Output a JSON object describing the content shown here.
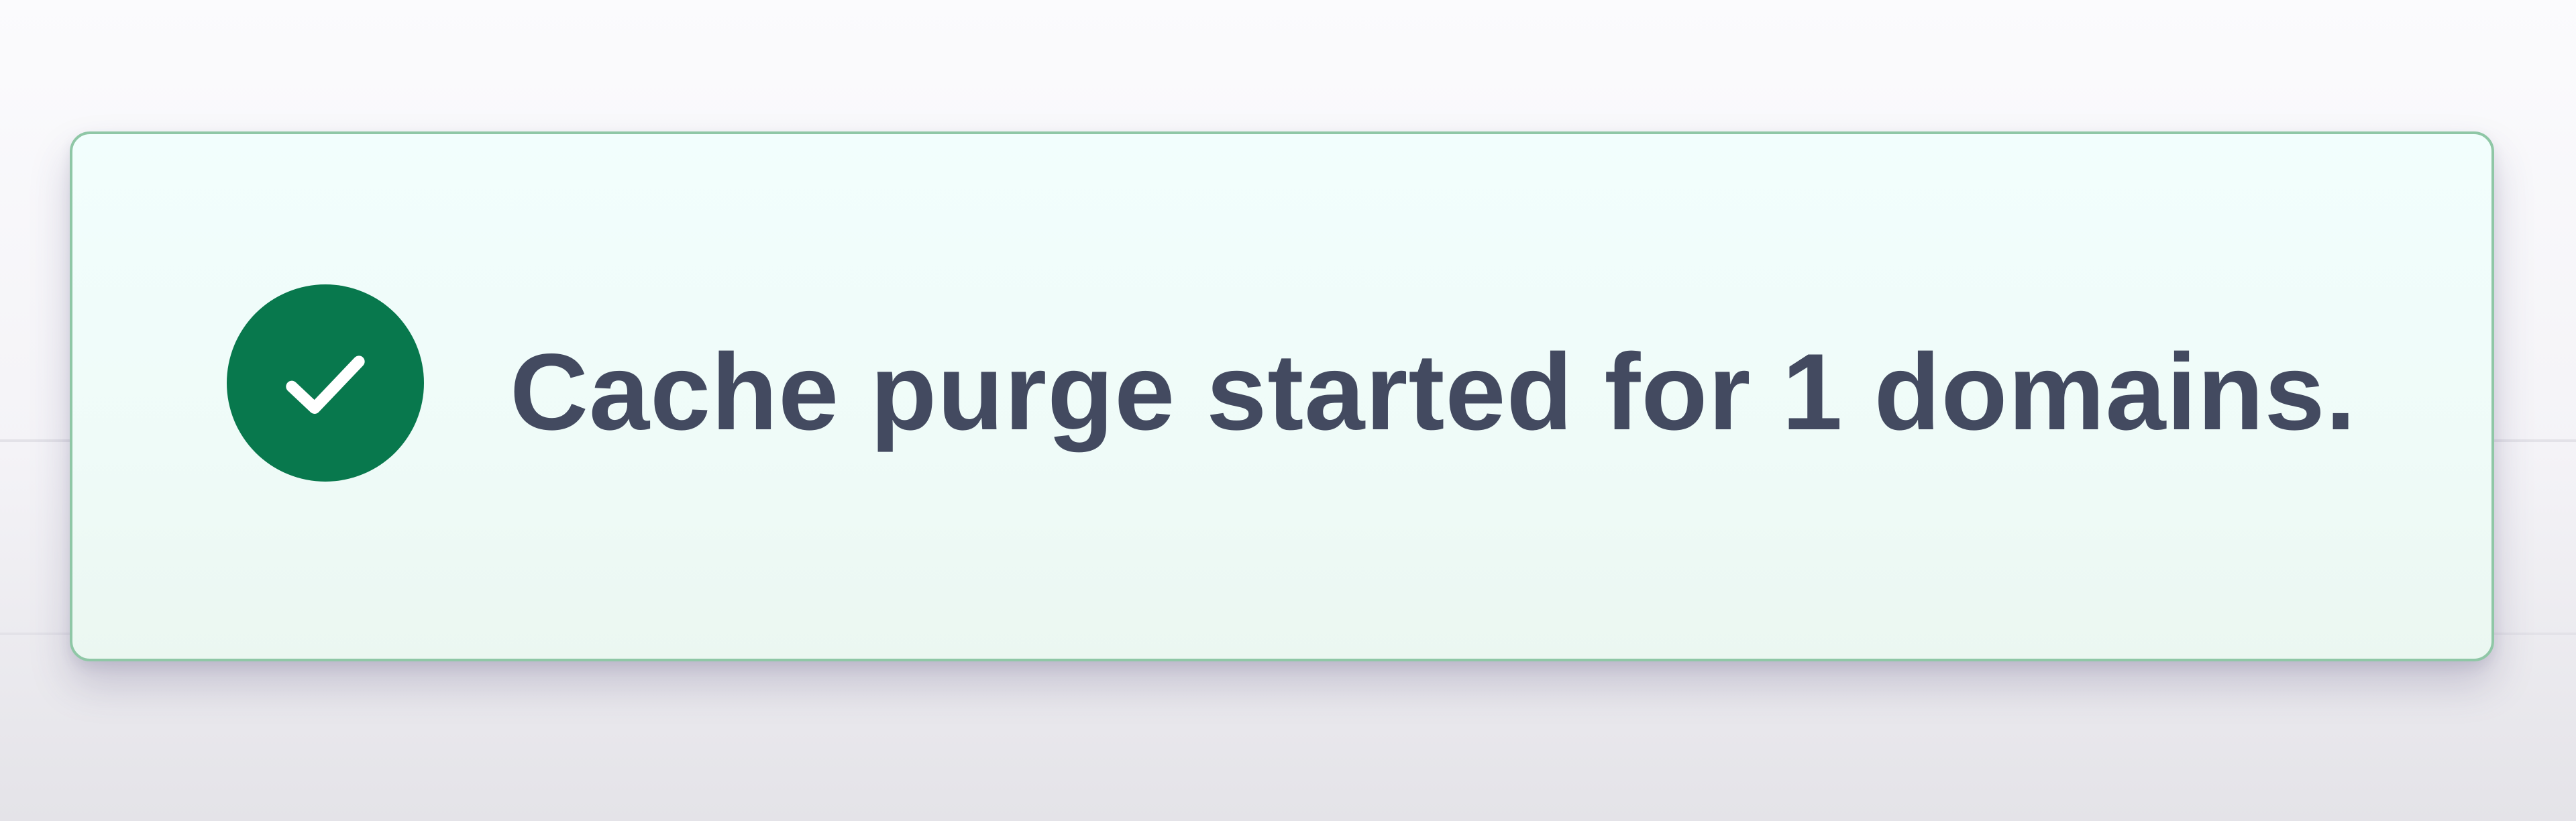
{
  "toast": {
    "message": "Cache purge started for 1 domains.",
    "icon": "check-circle-icon",
    "status": "success"
  },
  "colors": {
    "success_accent": "#08784d",
    "toast_background": "#f0fcf9",
    "toast_border": "#8fc7a6",
    "message_text": "#434a60"
  }
}
